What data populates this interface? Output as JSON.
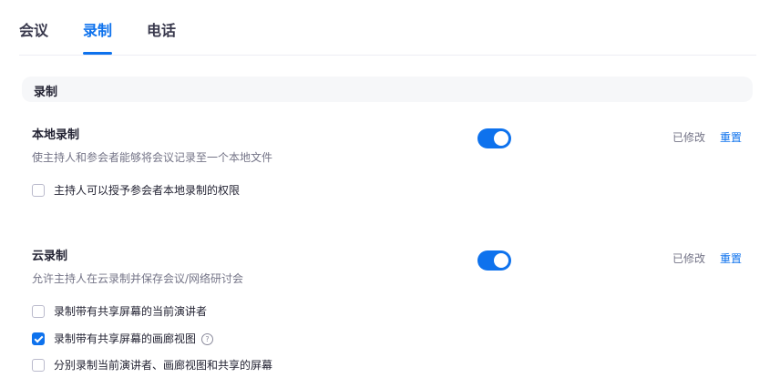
{
  "tabs": [
    {
      "label": "会议",
      "active": false
    },
    {
      "label": "录制",
      "active": true
    },
    {
      "label": "电话",
      "active": false
    }
  ],
  "section": {
    "title": "录制"
  },
  "local_recording": {
    "title": "本地录制",
    "description": "使主持人和参会者能够将会议记录至一个本地文件",
    "enabled": true,
    "modified_label": "已修改",
    "reset_label": "重置",
    "options": [
      {
        "label": "主持人可以授予参会者本地录制的权限",
        "checked": false
      }
    ]
  },
  "cloud_recording": {
    "title": "云录制",
    "description": "允许主持人在云录制并保存会议/网络研讨会",
    "enabled": true,
    "modified_label": "已修改",
    "reset_label": "重置",
    "options": [
      {
        "label": "录制带有共享屏幕的当前演讲者",
        "checked": false
      },
      {
        "label": "录制带有共享屏幕的画廊视图",
        "checked": true,
        "help_icon": "question-circle-icon"
      },
      {
        "label": "分别录制当前演讲者、画廊视图和共享的屏幕",
        "checked": false
      }
    ]
  },
  "colors": {
    "accent": "#0e72ed",
    "text": "#232333",
    "muted": "#747487",
    "section_bg": "#f6f7f9"
  }
}
